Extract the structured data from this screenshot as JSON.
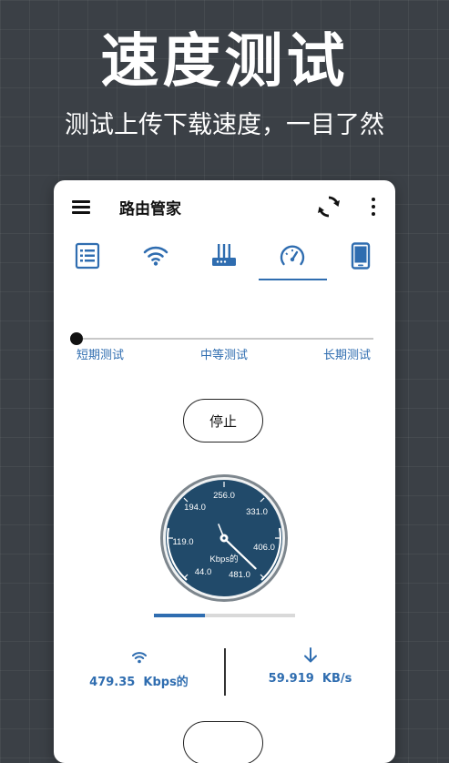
{
  "hero": {
    "title": "速度测试",
    "subtitle": "测试上传下载速度，一目了然"
  },
  "appbar": {
    "title": "路由管家"
  },
  "tabs": [
    {
      "icon": "list-icon"
    },
    {
      "icon": "wifi-icon"
    },
    {
      "icon": "router-icon"
    },
    {
      "icon": "speedometer-icon",
      "active": true
    },
    {
      "icon": "phone-icon"
    }
  ],
  "test_duration": {
    "options": [
      "短期测试",
      "中等测试",
      "长期测试"
    ],
    "selected": "短期测试"
  },
  "stop_button": {
    "label": "停止"
  },
  "gauge": {
    "ticks": [
      "256.0",
      "331.0",
      "406.0",
      "481.0",
      "44.0",
      "119.0",
      "194.0"
    ],
    "unit": "Kbps的",
    "current_value": 479.35
  },
  "progress": {
    "fraction": 0.36
  },
  "stats": {
    "wifi": {
      "value": "479.35",
      "unit": "Kbps的"
    },
    "download": {
      "value": "59.919",
      "unit": "KB/s"
    }
  },
  "colors": {
    "accent": "#2f6db0",
    "gauge_face": "#214a6a"
  }
}
